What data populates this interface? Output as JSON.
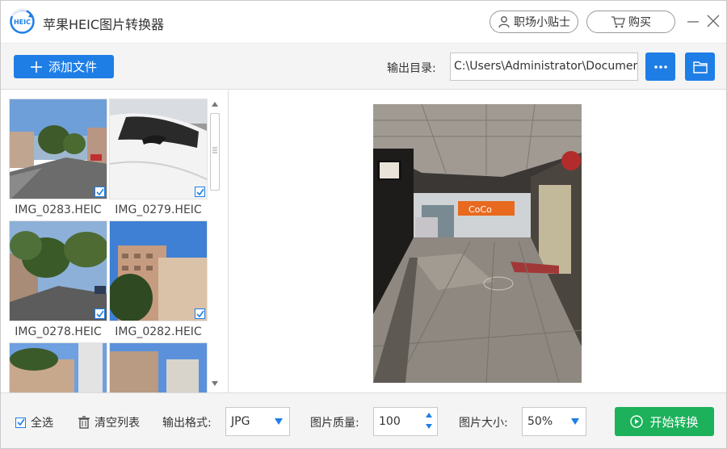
{
  "app": {
    "title": "苹果HEIC图片转换器",
    "logo_text": "HEIC",
    "tips_label": "职场小贴士",
    "buy_label": "购买"
  },
  "toolbar": {
    "add_files_label": "添加文件",
    "output_dir_label": "输出目录:",
    "output_dir_value": "C:\\Users\\Administrator\\Documents"
  },
  "files": [
    {
      "name": "IMG_0283.HEIC",
      "checked": true,
      "icon": "street-photo"
    },
    {
      "name": "IMG_0279.HEIC",
      "checked": true,
      "icon": "car-photo"
    },
    {
      "name": "IMG_0278.HEIC",
      "checked": true,
      "icon": "street-trees-photo"
    },
    {
      "name": "IMG_0282.HEIC",
      "checked": true,
      "icon": "buildings-photo"
    },
    {
      "name": "",
      "checked": false,
      "icon": "buildings-photo"
    },
    {
      "name": "",
      "checked": false,
      "icon": "buildings-photo"
    }
  ],
  "bottom": {
    "select_all_label": "全选",
    "clear_list_label": "清空列表",
    "format_label": "输出格式:",
    "format_value": "JPG",
    "quality_label": "图片质量:",
    "quality_value": "100",
    "size_label": "图片大小:",
    "size_value": "50%",
    "start_label": "开始转换"
  },
  "colors": {
    "accent": "#1e7ee6",
    "start": "#1cb15a"
  }
}
